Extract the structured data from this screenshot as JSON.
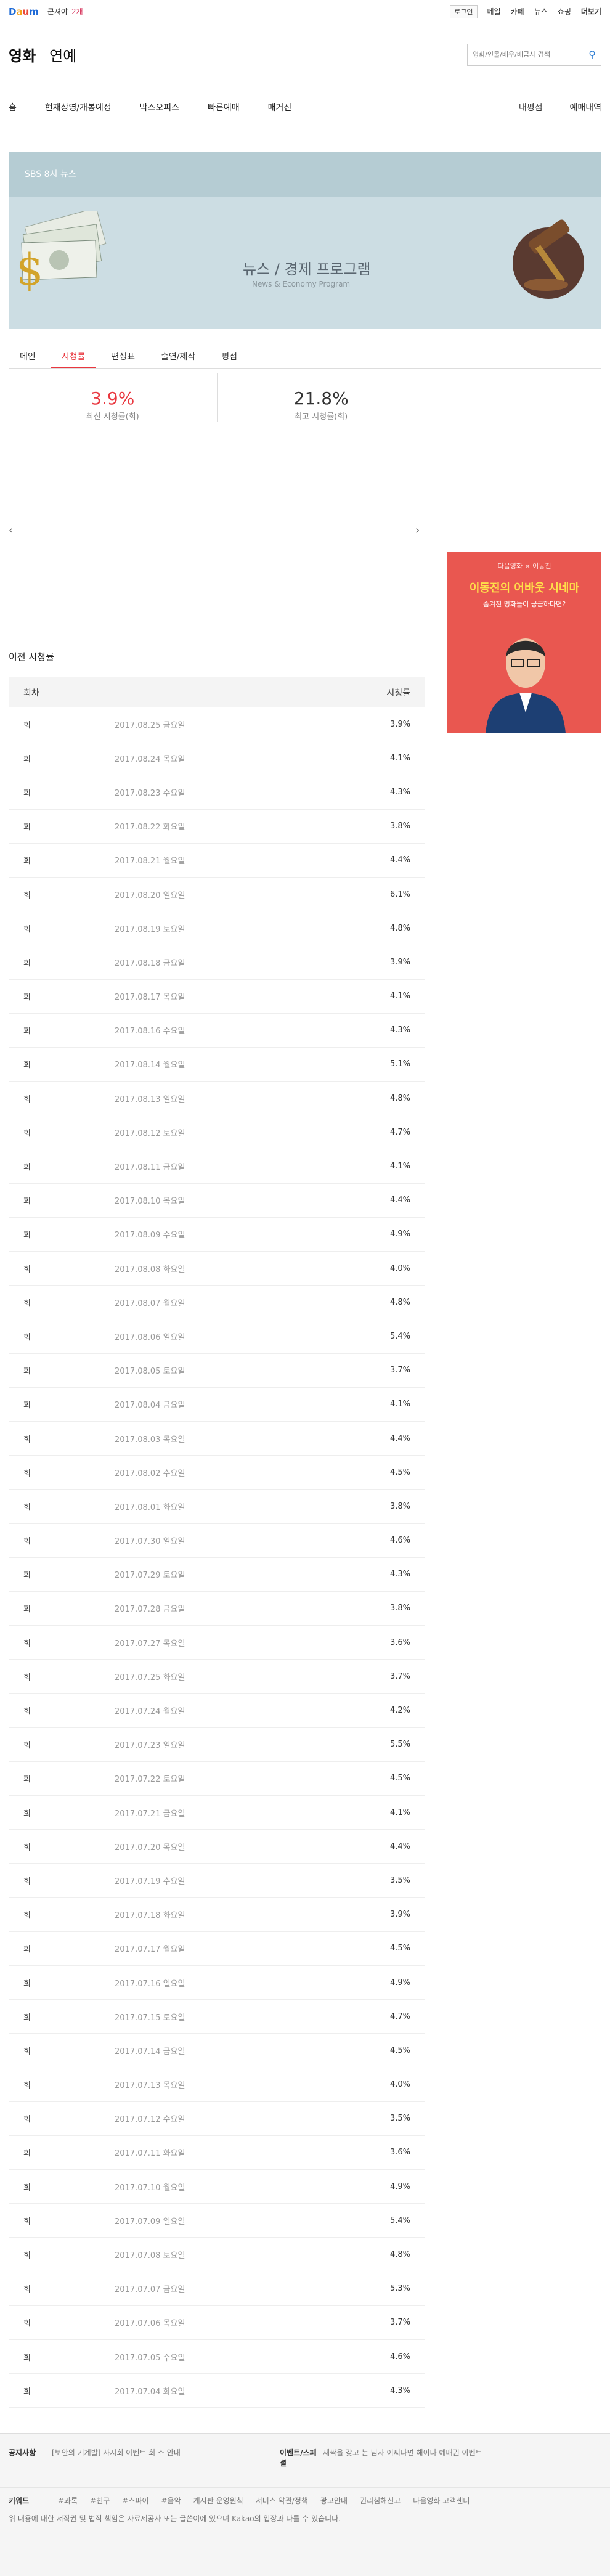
{
  "topbar": {
    "logo": [
      "D",
      "a",
      "u",
      "m"
    ],
    "ticker_label": "쿤셔야",
    "ticker_value": "2개",
    "login": "로그인",
    "links": [
      "메일",
      "카페",
      "뉴스",
      "쇼핑"
    ],
    "more": "더보기"
  },
  "subhead": {
    "categories": [
      "영화",
      "연예"
    ],
    "search_placeholder": "영화/인물/배우/배급사 검색"
  },
  "gnb": {
    "items": [
      "홈",
      "현재상영/개봉예정",
      "박스오피스",
      "빠른예매",
      "매거진"
    ],
    "right": [
      "내평점",
      "예매내역"
    ]
  },
  "banner": {
    "program": "SBS 8시 뉴스",
    "title": "뉴스 / 경제 프로그램",
    "subtitle": "News & Economy Program"
  },
  "tabs": [
    "메인",
    "시청률",
    "편성표",
    "출연/제작",
    "평점"
  ],
  "ratings": {
    "latest_value": "3.9%",
    "latest_label": "최신 시청률(회)",
    "max_value": "21.8%",
    "max_label": "최고 시청률(회)"
  },
  "ad": {
    "top": "다음영화 × 이동진",
    "title": "이동진의 어바웃 시네마",
    "sub": "숨겨진 명화들이 궁금하다면?"
  },
  "section_title": "이전 시청률",
  "table": {
    "col1": "회차",
    "col2": "시청률",
    "rows": [
      [
        "회",
        "2017.08.25 금요일",
        "3.9%"
      ],
      [
        "회",
        "2017.08.24 목요일",
        "4.1%"
      ],
      [
        "회",
        "2017.08.23 수요일",
        "4.3%"
      ],
      [
        "회",
        "2017.08.22 화요일",
        "3.8%"
      ],
      [
        "회",
        "2017.08.21 월요일",
        "4.4%"
      ],
      [
        "회",
        "2017.08.20 일요일",
        "6.1%"
      ],
      [
        "회",
        "2017.08.19 토요일",
        "4.8%"
      ],
      [
        "회",
        "2017.08.18 금요일",
        "3.9%"
      ],
      [
        "회",
        "2017.08.17 목요일",
        "4.1%"
      ],
      [
        "회",
        "2017.08.16 수요일",
        "4.3%"
      ],
      [
        "회",
        "2017.08.14 월요일",
        "5.1%"
      ],
      [
        "회",
        "2017.08.13 일요일",
        "4.8%"
      ],
      [
        "회",
        "2017.08.12 토요일",
        "4.7%"
      ],
      [
        "회",
        "2017.08.11 금요일",
        "4.1%"
      ],
      [
        "회",
        "2017.08.10 목요일",
        "4.4%"
      ],
      [
        "회",
        "2017.08.09 수요일",
        "4.9%"
      ],
      [
        "회",
        "2017.08.08 화요일",
        "4.0%"
      ],
      [
        "회",
        "2017.08.07 월요일",
        "4.8%"
      ],
      [
        "회",
        "2017.08.06 일요일",
        "5.4%"
      ],
      [
        "회",
        "2017.08.05 토요일",
        "3.7%"
      ],
      [
        "회",
        "2017.08.04 금요일",
        "4.1%"
      ],
      [
        "회",
        "2017.08.03 목요일",
        "4.4%"
      ],
      [
        "회",
        "2017.08.02 수요일",
        "4.5%"
      ],
      [
        "회",
        "2017.08.01 화요일",
        "3.8%"
      ],
      [
        "회",
        "2017.07.30 일요일",
        "4.6%"
      ],
      [
        "회",
        "2017.07.29 토요일",
        "4.3%"
      ],
      [
        "회",
        "2017.07.28 금요일",
        "3.8%"
      ],
      [
        "회",
        "2017.07.27 목요일",
        "3.6%"
      ],
      [
        "회",
        "2017.07.25 화요일",
        "3.7%"
      ],
      [
        "회",
        "2017.07.24 월요일",
        "4.2%"
      ],
      [
        "회",
        "2017.07.23 일요일",
        "5.5%"
      ],
      [
        "회",
        "2017.07.22 토요일",
        "4.5%"
      ],
      [
        "회",
        "2017.07.21 금요일",
        "4.1%"
      ],
      [
        "회",
        "2017.07.20 목요일",
        "4.4%"
      ],
      [
        "회",
        "2017.07.19 수요일",
        "3.5%"
      ],
      [
        "회",
        "2017.07.18 화요일",
        "3.9%"
      ],
      [
        "회",
        "2017.07.17 월요일",
        "4.5%"
      ],
      [
        "회",
        "2017.07.16 일요일",
        "4.9%"
      ],
      [
        "회",
        "2017.07.15 토요일",
        "4.7%"
      ],
      [
        "회",
        "2017.07.14 금요일",
        "4.5%"
      ],
      [
        "회",
        "2017.07.13 목요일",
        "4.0%"
      ],
      [
        "회",
        "2017.07.12 수요일",
        "3.5%"
      ],
      [
        "회",
        "2017.07.11 화요일",
        "3.6%"
      ],
      [
        "회",
        "2017.07.10 월요일",
        "4.9%"
      ],
      [
        "회",
        "2017.07.09 일요일",
        "5.4%"
      ],
      [
        "회",
        "2017.07.08 토요일",
        "4.8%"
      ],
      [
        "회",
        "2017.07.07 금요일",
        "5.3%"
      ],
      [
        "회",
        "2017.07.06 목요일",
        "3.7%"
      ],
      [
        "회",
        "2017.07.05 수요일",
        "4.6%"
      ],
      [
        "회",
        "2017.07.04 화요일",
        "4.3%"
      ]
    ]
  },
  "footer": {
    "notice_label": "공지사항",
    "notice_text": "[보안의 기계발] 사시회 이벤트 회 소 안내",
    "event_label": "이벤트/스페셜",
    "event_text": "새싹을 갖고 논 님자 어쩌다면 해이다 예매권 이벤트",
    "links_label": "키워드",
    "links": [
      "#과록",
      "#친구",
      "#스파이",
      "#음악",
      "게시판 운영원칙",
      "서비스 약관/정책",
      "광고안내",
      "권리침해신고",
      "다음영화 고객센터"
    ],
    "bottom": "위 내용에 대한 저작권 및 법적 책임은 자료제공사 또는 글쓴이에 있으며 Kakao의 입장과 다를 수 있습니다."
  }
}
